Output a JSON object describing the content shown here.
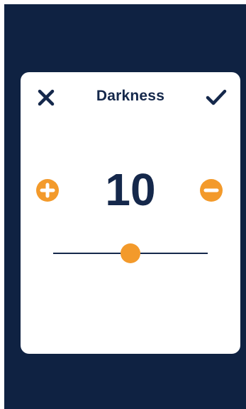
{
  "dialog": {
    "title": "Darkness",
    "value": "10",
    "slider_fraction": 0.5
  },
  "icons": {
    "close": "close-icon",
    "confirm": "checkmark-icon",
    "increment": "plus-circle-icon",
    "decrement": "minus-circle-icon"
  },
  "colors": {
    "background": "#0f2242",
    "dialog": "#ffffff",
    "text": "#15284b",
    "accent": "#f39a2b"
  }
}
